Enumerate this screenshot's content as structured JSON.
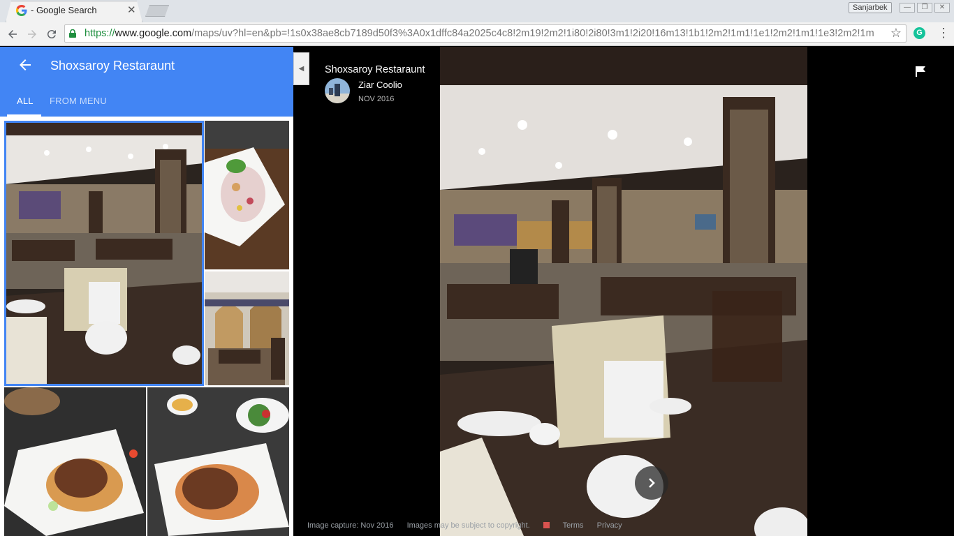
{
  "browser": {
    "tab_title": "- Google Search",
    "tab_close": "✕",
    "profile_name": "Sanjarbek",
    "url_scheme": "https://",
    "url_host": "www.google.com",
    "url_path": "/maps/uv?hl=en&pb=!1s0x38ae8cb7189d50f3%3A0x1dffc84a2025c4c8!2m19!2m2!1i80!2i80!3m1!2i20!16m13!1b1!2m2!1m1!1e1!2m2!1m1!1e3!2m2!1m",
    "icons": [
      "google-favicon",
      "back-icon",
      "forward-icon",
      "reload-icon",
      "lock-icon",
      "star-icon",
      "grammarly-icon",
      "menu-icon"
    ],
    "accent_color": "#4285f4"
  },
  "panel": {
    "title": "Shoxsaroy Restaraunt",
    "tabs": [
      {
        "label": "ALL",
        "active": true
      },
      {
        "label": "FROM MENU",
        "active": false
      }
    ]
  },
  "viewer": {
    "place_name": "Shoxsaroy Restaraunt",
    "author": "Ziar Coolio",
    "date": "NOV 2016",
    "next_label": "›",
    "footer": {
      "capture": "Image capture: Nov 2016",
      "copyright": "Images may be subject to copyright.",
      "terms": "Terms",
      "privacy": "Privacy"
    }
  }
}
